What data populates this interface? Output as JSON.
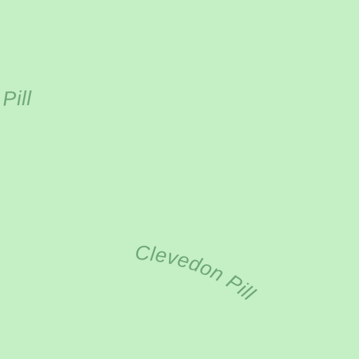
{
  "map": {
    "background_color": "#c5efc5",
    "label_color": "#6fa879",
    "labels": [
      {
        "text": "Clevedon Pill"
      },
      {
        "text": "Clevedon Pill"
      }
    ]
  }
}
